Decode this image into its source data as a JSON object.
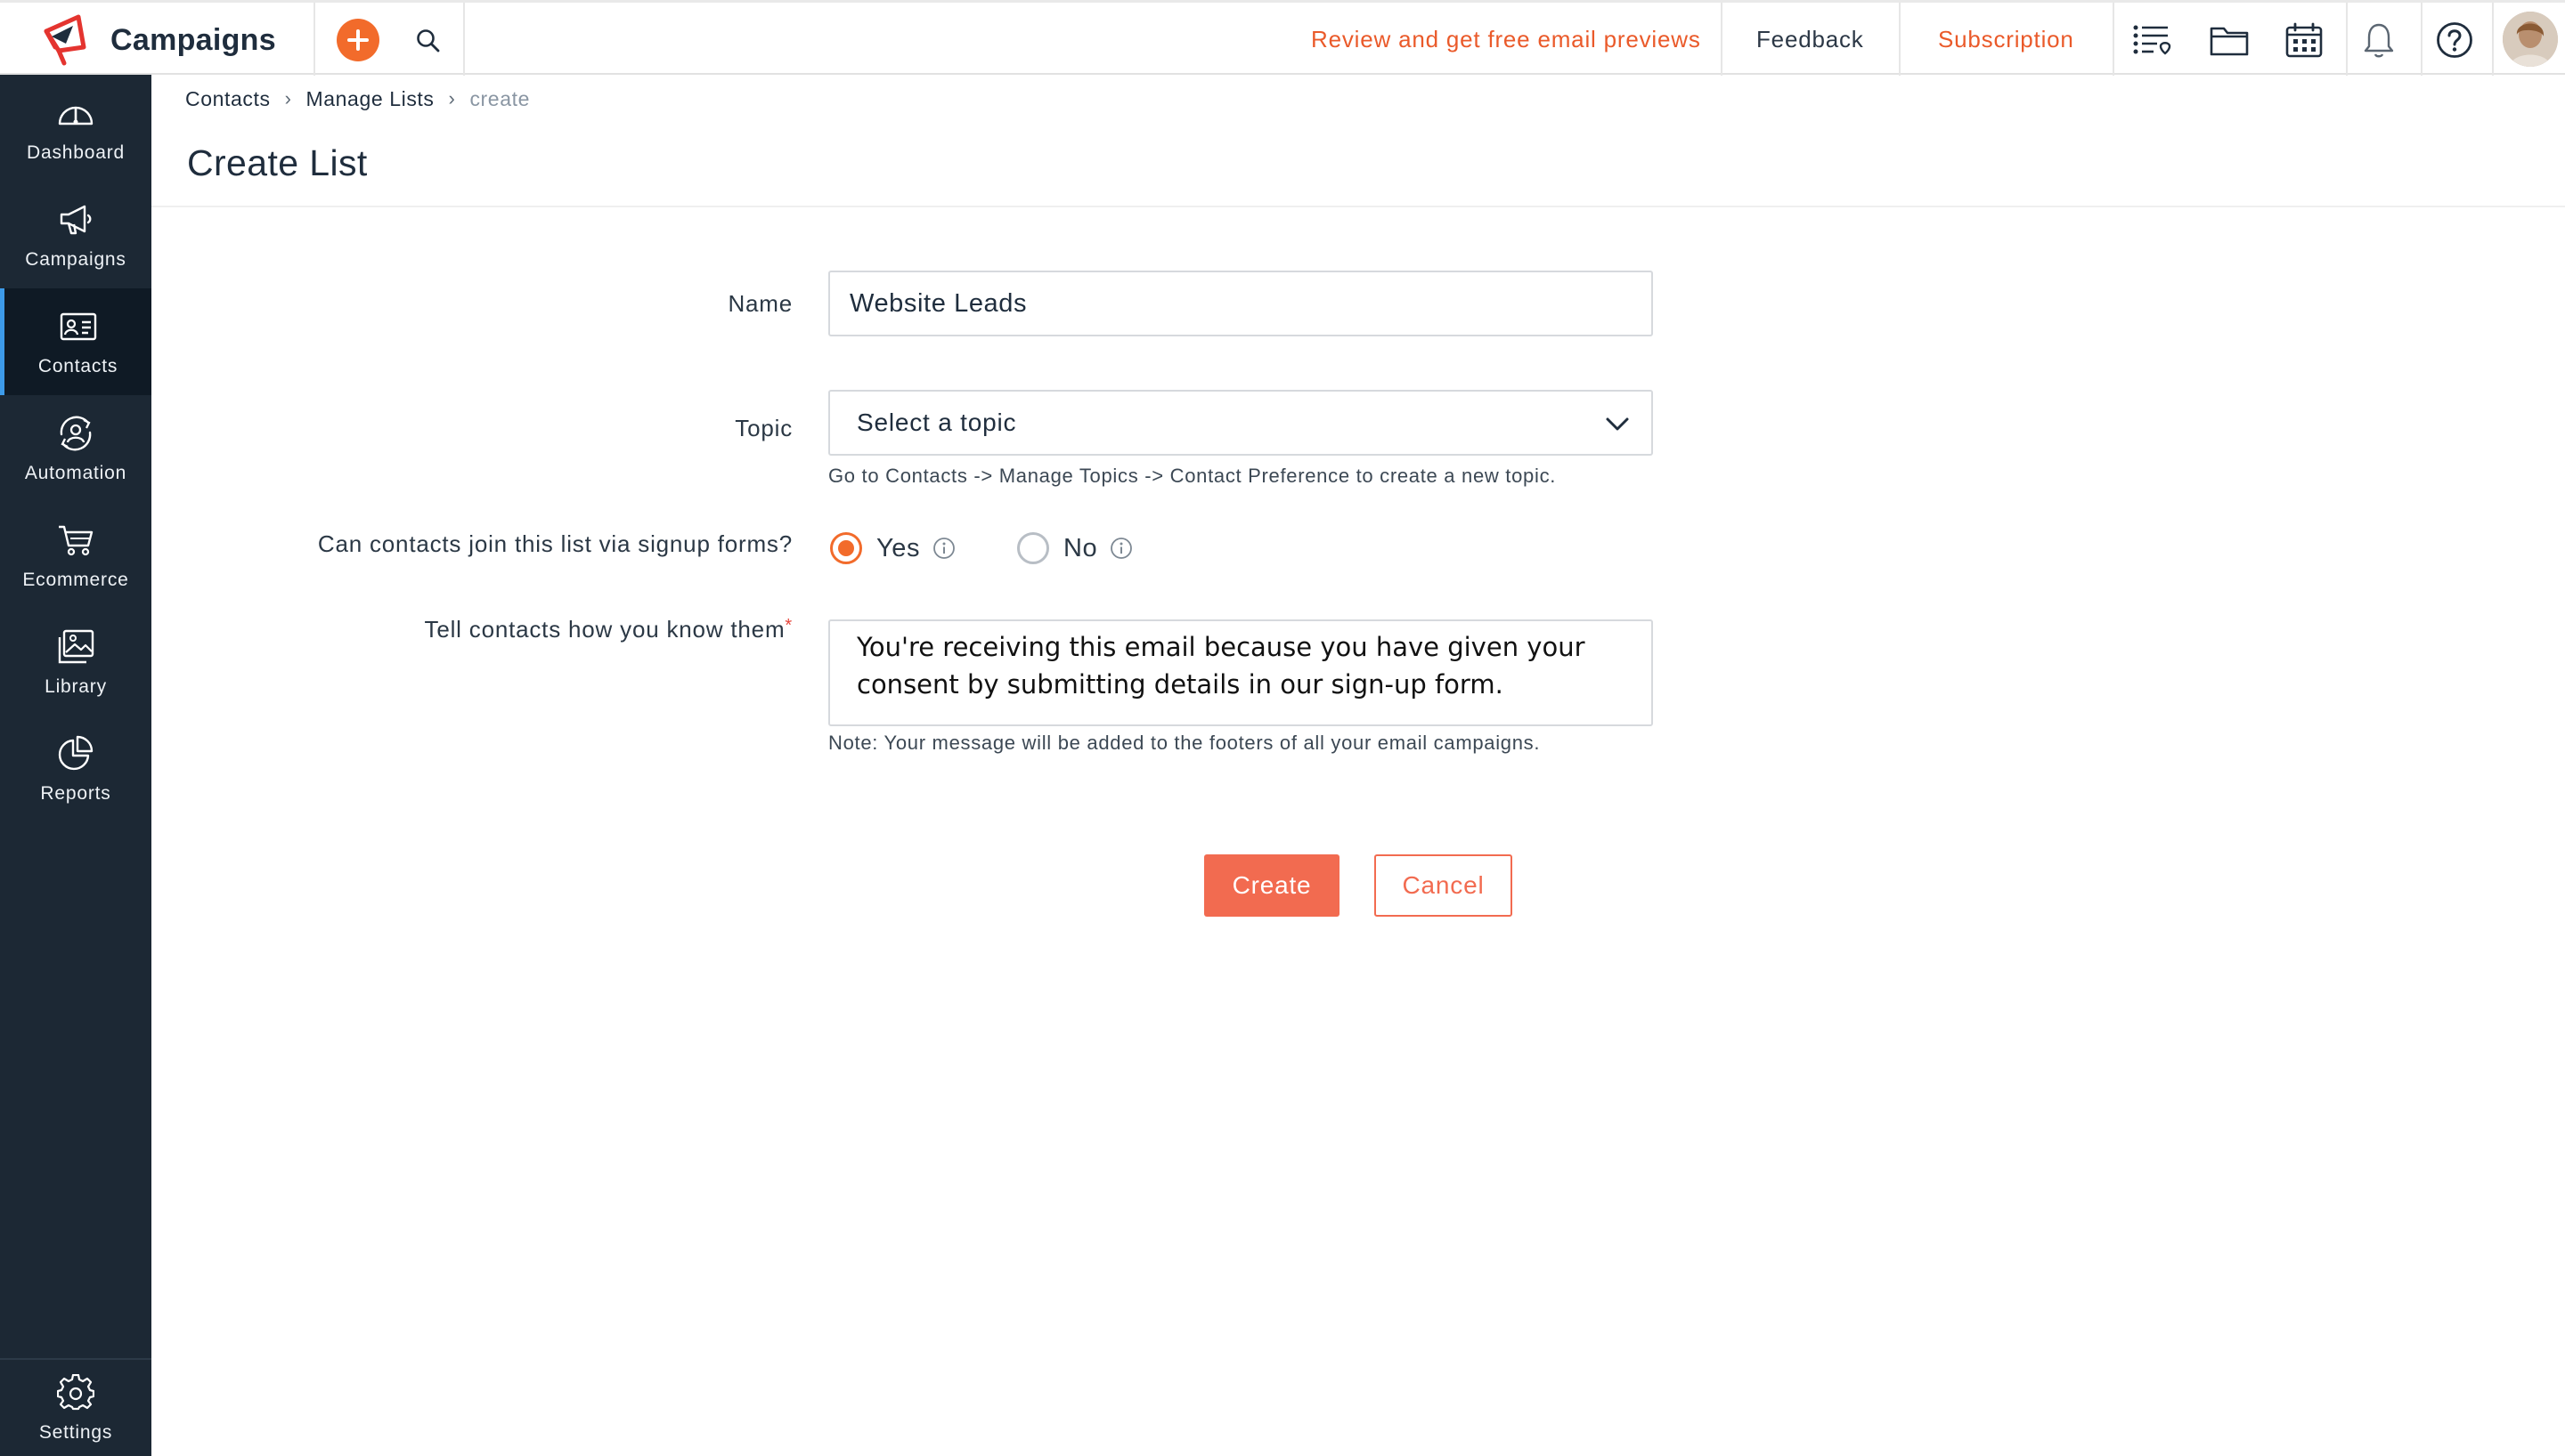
{
  "app": {
    "title": "Campaigns",
    "logo_icon": "campaigns-logo-icon",
    "brand_color": "#e4342f",
    "accent_color": "#f26b2b"
  },
  "topbar": {
    "add_icon": "plus-icon",
    "search_icon": "search-icon",
    "promo_link": "Review and get free email previews",
    "feedback_link": "Feedback",
    "subscription_link": "Subscription",
    "icons": [
      "checklist-icon",
      "folder-icon",
      "calendar-icon",
      "bell-icon",
      "help-icon"
    ],
    "avatar": "user-avatar"
  },
  "sidebar": {
    "items": [
      {
        "label": "Dashboard",
        "icon": "gauge-icon"
      },
      {
        "label": "Campaigns",
        "icon": "megaphone-icon"
      },
      {
        "label": "Contacts",
        "icon": "contact-card-icon",
        "active": true
      },
      {
        "label": "Automation",
        "icon": "automation-icon"
      },
      {
        "label": "Ecommerce",
        "icon": "cart-icon"
      },
      {
        "label": "Library",
        "icon": "image-library-icon"
      },
      {
        "label": "Reports",
        "icon": "pie-chart-icon"
      }
    ],
    "settings": {
      "label": "Settings",
      "icon": "gear-icon"
    },
    "active_color": "#3d9be9",
    "background": "#1c2834"
  },
  "breadcrumb": {
    "items": [
      "Contacts",
      "Manage Lists",
      "create"
    ]
  },
  "page": {
    "title": "Create List"
  },
  "form": {
    "name": {
      "label": "Name",
      "value": "Website Leads"
    },
    "topic": {
      "label": "Topic",
      "selected": "Select a topic",
      "hint": "Go to Contacts -> Manage Topics -> Contact Preference to create a new topic."
    },
    "signup": {
      "label": "Can contacts join this list via signup forms?",
      "options": [
        {
          "label": "Yes",
          "selected": true
        },
        {
          "label": "No",
          "selected": false
        }
      ]
    },
    "know_them": {
      "label": "Tell contacts how you know them",
      "required_mark": "*",
      "value": "You're receiving this email because you have given your consent by submitting details in our sign-up form.",
      "note": "Note: Your message will be added to the footers of all your email campaigns."
    },
    "actions": {
      "create": "Create",
      "cancel": "Cancel"
    }
  }
}
